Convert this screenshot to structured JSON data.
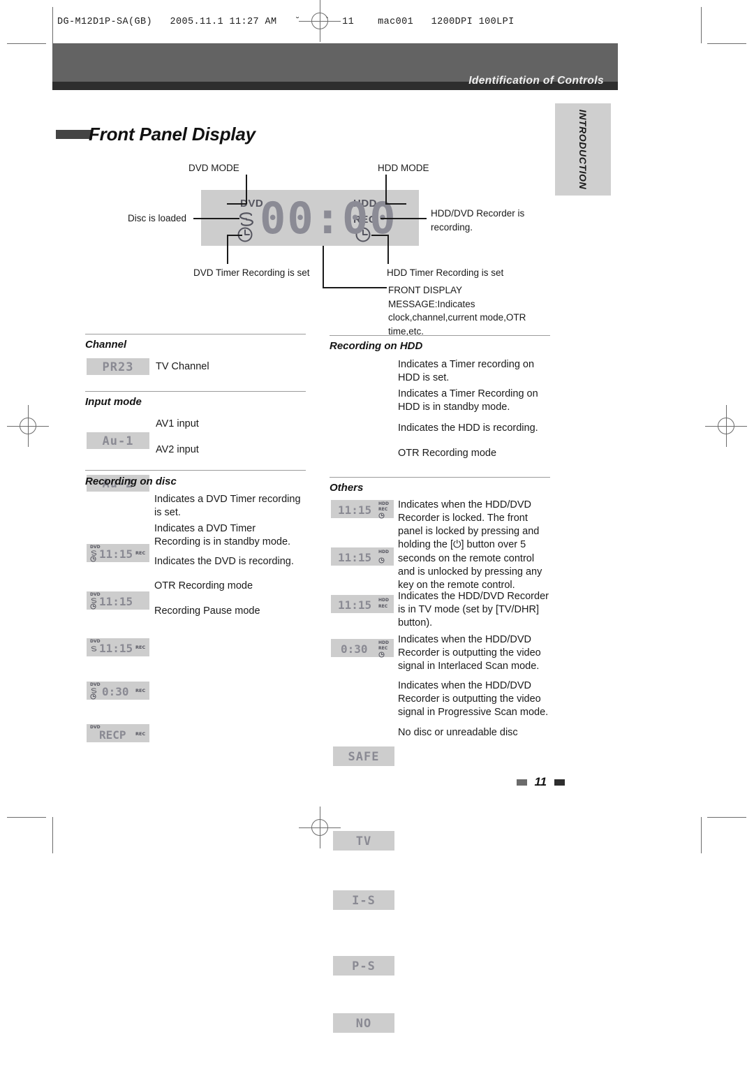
{
  "prepress": {
    "slug": "DG-M12D1P-SA(GB)   2005.11.1 11:27 AM   ˘    `  11    mac001   1200DPI 100LPI"
  },
  "header": {
    "running_title": "Identification of Controls",
    "side_tab": "INTRODUCTION"
  },
  "page_title": "Front Panel Display",
  "diagram": {
    "label_dvd_mode": "DVD MODE",
    "label_hdd_mode": "HDD MODE",
    "label_disc_loaded": "Disc is loaded",
    "label_recording": "HDD/DVD Recorder is recording.",
    "label_dvd_timer": "DVD Timer Recording is set",
    "label_hdd_timer": "HDD Timer Recording is set",
    "label_front_msg": "FRONT DISPLAY MESSAGE:Indicates clock,channel,current mode,OTR time,etc.",
    "panel": {
      "dvd": "DVD",
      "hdd": "HDD",
      "rec": "REC",
      "digits": "00:00"
    }
  },
  "sections": {
    "channel": {
      "heading": "Channel",
      "rows": [
        {
          "display": "PR23",
          "desc": "TV Channel"
        }
      ]
    },
    "input_mode": {
      "heading": "Input mode",
      "rows": [
        {
          "display": "Au-1",
          "desc": "AV1 input"
        },
        {
          "display": "Au-2",
          "desc": "AV2 input"
        }
      ]
    },
    "recording_on_disc": {
      "heading": "Recording on disc",
      "rows": [
        {
          "tag": "DVD",
          "disc_icon": "disc-icon",
          "clock_icon": "clock-icon",
          "display": "11:15",
          "rec": "REC",
          "desc": "Indicates a DVD Timer recording is set."
        },
        {
          "tag": "DVD",
          "disc_icon": "disc-icon",
          "clock_icon": "clock-icon",
          "display": "11:15",
          "rec": "",
          "desc": "Indicates a DVD Timer Recording is in standby mode."
        },
        {
          "tag": "DVD",
          "disc_icon": "disc-icon",
          "clock_icon": "",
          "display": "11:15",
          "rec": "REC",
          "desc": "Indicates the DVD is recording."
        },
        {
          "tag": "DVD",
          "disc_icon": "disc-icon",
          "clock_icon": "clock-icon",
          "display": "0:30",
          "rec": "REC",
          "desc": "OTR Recording mode"
        },
        {
          "tag": "DVD",
          "disc_icon": "",
          "clock_icon": "",
          "display": "RECP",
          "rec": "REC",
          "desc": "Recording Pause mode"
        }
      ]
    },
    "recording_on_hdd": {
      "heading": "Recording on HDD",
      "rows": [
        {
          "display": "11:15",
          "tag": "HDD",
          "rec": "REC",
          "clock_icon": "clock-icon",
          "desc": "Indicates a Timer recording on HDD is set."
        },
        {
          "display": "11:15",
          "tag": "HDD",
          "rec": "",
          "clock_icon": "clock-icon",
          "desc": "Indicates a Timer Recording on HDD is in standby mode."
        },
        {
          "display": "11:15",
          "tag": "HDD",
          "rec": "REC",
          "clock_icon": "",
          "desc": "Indicates the HDD is recording."
        },
        {
          "display": "0:30",
          "tag": "HDD",
          "rec": "REC",
          "clock_icon": "clock-icon",
          "desc": "OTR Recording mode"
        }
      ]
    },
    "others": {
      "heading": "Others",
      "rows": [
        {
          "display": "SAFE",
          "desc": "Indicates when the HDD/DVD Recorder is locked. The front panel is locked by pressing and holding the [⏻] button over 5 seconds on the remote control and is unlocked by pressing any key on the remote control."
        },
        {
          "display": "TV",
          "desc": "Indicates the HDD/DVD Recorder is in TV mode (set by [TV/DHR] button)."
        },
        {
          "display": "I-S",
          "desc": "Indicates when the HDD/DVD Recorder is outputting the video signal in Interlaced Scan mode."
        },
        {
          "display": "P-S",
          "desc": "Indicates when the HDD/DVD Recorder is outputting the video signal in Progressive Scan mode."
        },
        {
          "display": "NO",
          "desc": "No disc or unreadable disc"
        }
      ]
    }
  },
  "footer": {
    "page_number": "11"
  },
  "colors": {
    "header_gray": "#636363",
    "header_dark": "#2e2e2e",
    "panel_gray": "#cdcdcd",
    "lcd_gray": "#8a8a93",
    "tab_gray": "#cfcfcf"
  }
}
